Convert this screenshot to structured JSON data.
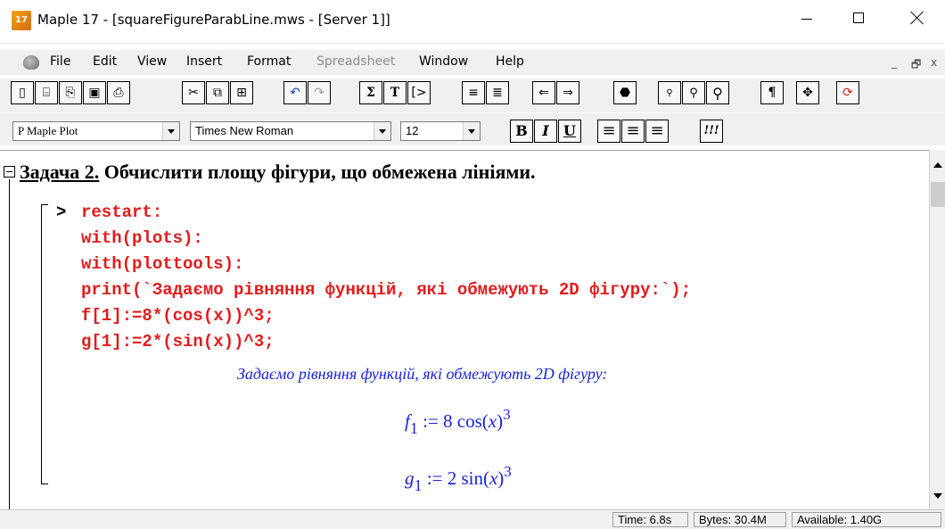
{
  "titlebar": {
    "app_icon_text": "17",
    "title": "Maple 17 - [squareFigureParabLine.mws - [Server 1]]"
  },
  "menu": {
    "items": [
      "File",
      "Edit",
      "View",
      "Insert",
      "Format",
      "Spreadsheet",
      "Window",
      "Help"
    ],
    "disabled": [
      "Spreadsheet"
    ],
    "mdi_controls": [
      "_",
      "ᴮ",
      "x"
    ]
  },
  "toolbar1": {
    "groups": [
      [
        "new-icon",
        "open-icon",
        "open-url-icon",
        "save-icon",
        "print-icon"
      ],
      [
        "cut-icon",
        "copy-icon",
        "paste-icon"
      ],
      [
        "undo-icon",
        "redo-icon"
      ],
      [
        "sigma-icon",
        "text-icon",
        "prompt-icon"
      ],
      [
        "collapse-icon",
        "expand-icon"
      ],
      [
        "back-icon",
        "forward-icon"
      ],
      [
        "stop-icon"
      ],
      [
        "zoom-small-icon",
        "zoom-medium-icon",
        "zoom-large-icon"
      ],
      [
        "pilcrow-icon"
      ],
      [
        "move-icon"
      ],
      [
        "restart-icon"
      ]
    ],
    "glyphs": {
      "sigma-icon": "Σ",
      "text-icon": "T",
      "prompt-icon": "[>",
      "undo-icon": "↶",
      "redo-icon": "↷",
      "back-icon": "⇐",
      "forward-icon": "⇒",
      "pilcrow-icon": "¶",
      "move-icon": "✥",
      "stop-icon": "⬣",
      "zoom-small-icon": "🔍",
      "zoom-medium-icon": "🔍",
      "zoom-large-icon": "🔍",
      "new-icon": "▯",
      "open-icon": "📂",
      "open-url-icon": "⎘",
      "save-icon": "▣",
      "print-icon": "⎙",
      "cut-icon": "✂",
      "copy-icon": "⧉",
      "paste-icon": "📋",
      "collapse-icon": "≡",
      "expand-icon": "≣",
      "restart-icon": "⟳"
    }
  },
  "toolbar2": {
    "style": "P Maple Plot",
    "font": "Times New Roman",
    "size": "12",
    "format_buttons": [
      "B",
      "I",
      "U"
    ],
    "align_icons": [
      "align-left-icon",
      "align-center-icon",
      "align-right-icon"
    ],
    "exec_icon_text": "!!!"
  },
  "worksheet": {
    "heading_underlined": "Задача 2.",
    "heading_rest": " Обчислити площу фігури, що обмежена лініями.",
    "prompt": ">",
    "code": [
      "restart:",
      "with(plots):",
      "with(plottools):",
      "print(`Задаємо рівняння функцій, які обмежують 2D фігуру:`);",
      "f[1]:=8*(cos(x))^3;",
      "g[1]:=2*(sin(x))^3;"
    ],
    "output_text": "Задаємо рівняння функцій, які обмежують 2D фігуру:",
    "outputs": [
      {
        "name": "f",
        "sub": "1",
        "assign": ":=",
        "coef": "8",
        "func": "cos",
        "arg": "x",
        "power": "3"
      },
      {
        "name": "g",
        "sub": "1",
        "assign": ":=",
        "coef": "2",
        "func": "sin",
        "arg": "x",
        "power": "3"
      }
    ]
  },
  "status": {
    "time": "Time:  6.8s",
    "bytes": "Bytes: 30.4M",
    "available": "Available: 1.40G"
  }
}
